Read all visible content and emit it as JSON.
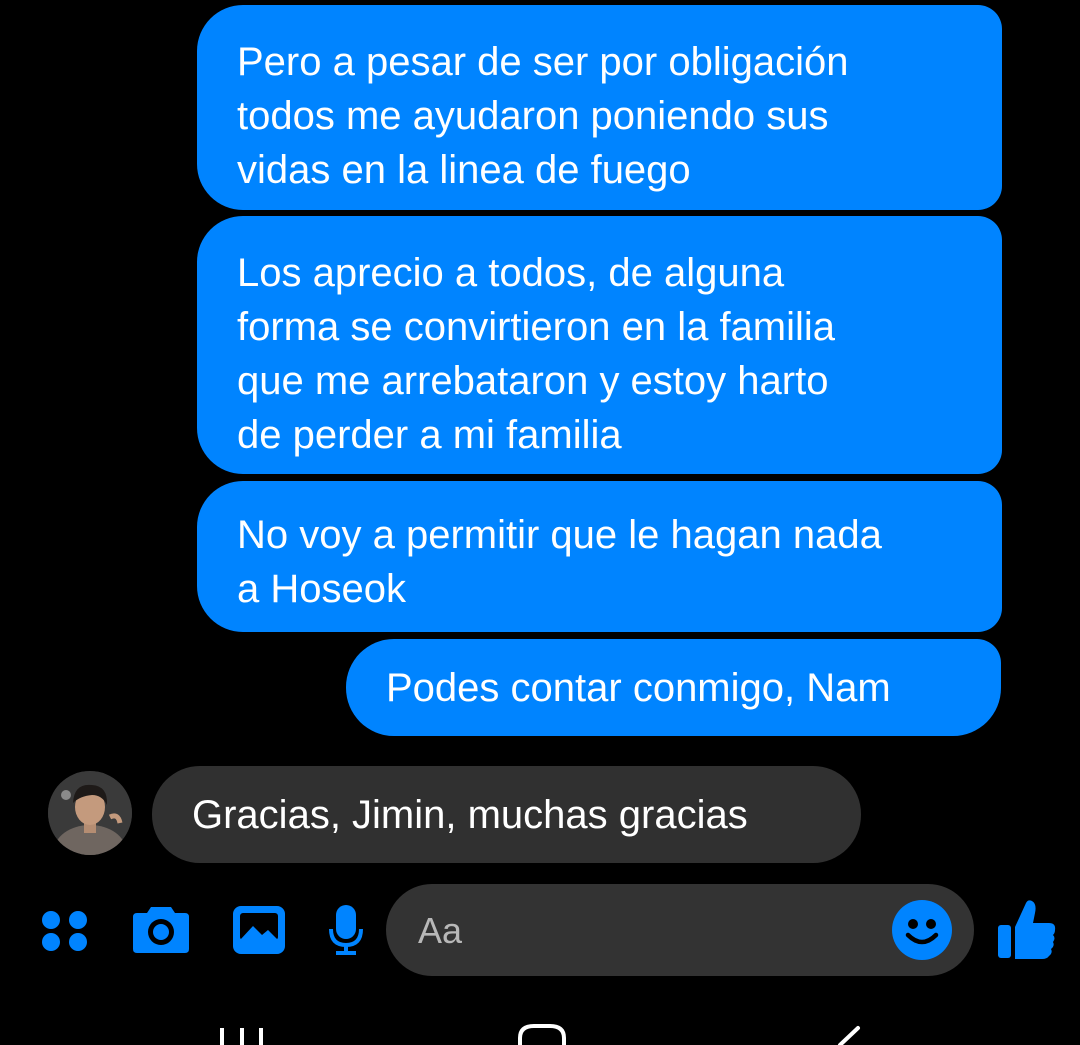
{
  "colors": {
    "background": "#000000",
    "outgoing_bubble": "#0084ff",
    "incoming_bubble": "#303030",
    "accent": "#0084ff",
    "composer_bg": "#333333",
    "text": "#ffffff"
  },
  "messages": [
    {
      "direction": "outgoing",
      "text": "Pero a pesar de ser por obligación\ntodos me ayudaron poniendo sus\nvidas en la linea de fuego"
    },
    {
      "direction": "outgoing",
      "text": "Los aprecio a todos, de alguna\nforma se convirtieron en la familia\nque me arrebataron y estoy harto\nde perder a mi familia"
    },
    {
      "direction": "outgoing",
      "text": "No voy a permitir que le hagan nada\na Hoseok"
    },
    {
      "direction": "outgoing",
      "text": "Podes contar conmigo, Nam"
    },
    {
      "direction": "incoming",
      "text": "Gracias, Jimin, muchas gracias"
    }
  ],
  "composer": {
    "placeholder": "Aa",
    "value": ""
  },
  "toolbar_icons": [
    "menu-dots-icon",
    "camera-icon",
    "gallery-icon",
    "microphone-icon",
    "emoji-icon",
    "like-thumb-icon"
  ],
  "navbar_icons": [
    "recent-apps-icon",
    "home-icon",
    "back-icon"
  ]
}
